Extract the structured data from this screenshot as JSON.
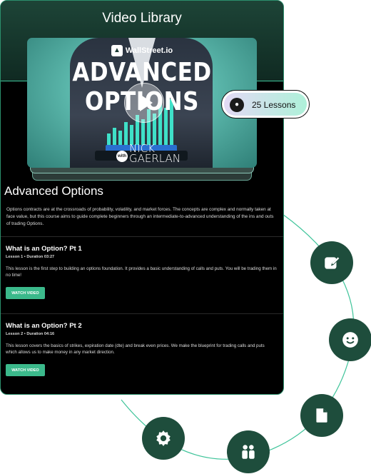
{
  "header": {
    "title": "Video Library"
  },
  "video": {
    "brand": "WallStreet.io",
    "thumbnail_title": "ADVANCED OPTIONS",
    "with_label": "with",
    "presenter_first": "NICK",
    "presenter_last": "GAERLAN"
  },
  "lessons_badge": {
    "label": "25 Lessons",
    "icon": "disc-icon"
  },
  "course": {
    "title": "Advanced Options",
    "description": "Options contracts are at the crossroads of probability, volatility, and market forces.  The concepts are complex and normally taken at face value, but this course aims to guide complete beginners through an intermediate-to-advanced understanding of the ins and outs of trading Options."
  },
  "lessons": [
    {
      "title": "What is an Option? Pt 1",
      "meta": "Lesson 1  •  Duration  03:27",
      "description": "This lesson is the first step to building an options foundation. It provides a basic understanding of calls and puts. You will be trading them in no time!",
      "button": "WATCH VIDEO"
    },
    {
      "title": "What is an Option? Pt 2",
      "meta": "Lesson 2  •  Duration  04:16",
      "description": "This lesson covers the basics of strikes, expiration date (dte) and break even prices. We make the blueprint for trading calls and puts which allows us to make money in any market direction.",
      "button": "WATCH VIDEO"
    }
  ],
  "features": [
    "edit-icon",
    "smile-icon",
    "file-icon",
    "users-icon",
    "gear-icon"
  ],
  "colors": {
    "accent": "#3bb98b",
    "dark_green": "#1e4d3c",
    "line": "#3fc49a"
  }
}
